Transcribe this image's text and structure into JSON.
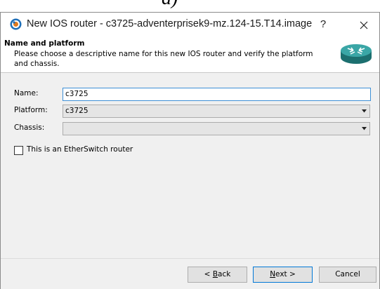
{
  "caption": "a)",
  "window": {
    "title": "New IOS router - c3725-adventerprisek9-mz.124-15.T14.image",
    "help_label": "?"
  },
  "header": {
    "title": "Name and platform",
    "description": "Please choose a descriptive name for this new IOS router and verify the platform and chassis."
  },
  "form": {
    "name_label": "Name:",
    "name_value": "c3725",
    "platform_label": "Platform:",
    "platform_value": "c3725",
    "chassis_label": "Chassis:",
    "chassis_value": "",
    "etherswitch_label": "This is an EtherSwitch router",
    "etherswitch_checked": false
  },
  "buttons": {
    "back_mnemonic": "B",
    "back_rest": "ack",
    "back_prefix": "< ",
    "next_mnemonic": "N",
    "next_rest": "ext >",
    "cancel": "Cancel"
  },
  "colors": {
    "focus_border": "#3d8fd6",
    "router_icon": "#2a8a8a"
  },
  "icons": {
    "app": "gns3-app-icon",
    "router": "router-icon",
    "close": "close-icon",
    "dropdown": "chevron-down-icon"
  }
}
